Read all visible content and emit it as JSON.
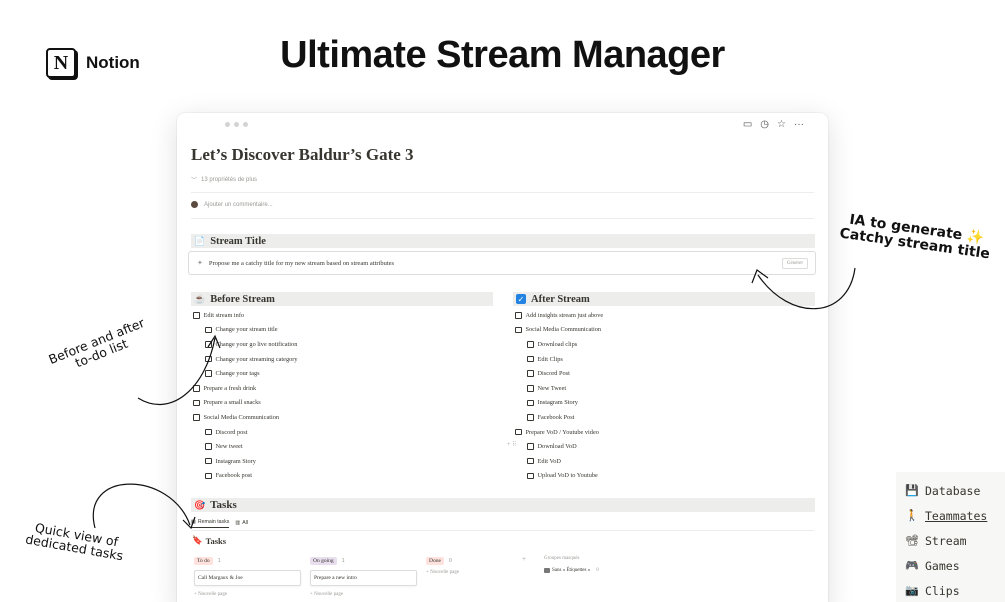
{
  "brand": {
    "logo_letter": "N",
    "name": "Notion"
  },
  "headline": "Ultimate Stream Manager",
  "window": {
    "top_icons": [
      "comment-icon",
      "history-icon",
      "star-icon",
      "more-icon"
    ],
    "top_icon_glyphs": [
      "▭",
      "◷",
      "☆",
      "···"
    ],
    "page_title": "Let’s Discover Baldur’s Gate 3",
    "properties_toggle": "13 propriétés de plus",
    "comment_placeholder": "Ajouter un commentaire...",
    "stream_title": {
      "icon": "📄",
      "heading": "Stream Title",
      "ai_prompt": "Propose me a catchy title for my new stream based on stream attributes",
      "generate_label": "Générer"
    },
    "before": {
      "icon": "☕",
      "heading": "Before Stream",
      "items": [
        {
          "label": "Edit stream info",
          "level": 0
        },
        {
          "label": "Change your stream title",
          "level": 1
        },
        {
          "label": "Change your go live notification",
          "level": 1
        },
        {
          "label": "Change your streaming category",
          "level": 1
        },
        {
          "label": "Change your tags",
          "level": 1
        },
        {
          "label": "Prepare a fresh drink",
          "level": 0
        },
        {
          "label": "Prepare a small snacks",
          "level": 0
        },
        {
          "label": "Social Media Communication",
          "level": 0
        },
        {
          "label": "Discord post",
          "level": 1
        },
        {
          "label": "New tweet",
          "level": 1
        },
        {
          "label": "Instagram Story",
          "level": 1
        },
        {
          "label": "Facebook post",
          "level": 1
        }
      ]
    },
    "after": {
      "icon": "✓",
      "heading": "After Stream",
      "items": [
        {
          "label": "Add insights stream just above",
          "level": 0
        },
        {
          "label": "Social Media Communication",
          "level": 0
        },
        {
          "label": "Download clips",
          "level": 1
        },
        {
          "label": "Edit Clips",
          "level": 1
        },
        {
          "label": "Discord Post",
          "level": 1
        },
        {
          "label": "New Tweet",
          "level": 1
        },
        {
          "label": "Instagram Story",
          "level": 1
        },
        {
          "label": "Facebook Post",
          "level": 1
        },
        {
          "label": "Prepare VoD / Youtube video",
          "level": 0
        },
        {
          "label": "Download VoD",
          "level": 1
        },
        {
          "label": "Edit VoD",
          "level": 1
        },
        {
          "label": "Upload VoD to Youtube",
          "level": 1
        }
      ]
    },
    "tasks": {
      "icon": "🎯",
      "heading": "Tasks",
      "tabs": [
        "Remain tasks",
        "All"
      ],
      "sub_icon": "🔖",
      "sub_heading": "Tasks",
      "columns": [
        {
          "label": "To do",
          "count": "1",
          "card": "Call Margaux & Joe",
          "new_page": "+ Nouvelle page",
          "color": "#ffe2dd"
        },
        {
          "label": "On going",
          "count": "1",
          "card": "Prepare a new intro",
          "new_page": "+ Nouvelle page",
          "color": "#e8deee"
        },
        {
          "label": "Done",
          "count": "0",
          "card": "",
          "new_page": "+ Nouvelle page",
          "color": "#ffe2dd"
        }
      ],
      "hidden_groups_label": "Groupes masqués",
      "hidden_groups_item": "Sans « Étiquettes »",
      "hidden_groups_count": "0"
    }
  },
  "annotations": {
    "ia_line1": "IA to generate",
    "ia_sparkle": "✨",
    "ia_line2": "Catchy stream title",
    "before_after_line1": "Before and after",
    "before_after_line2": "to-do list",
    "quick_view_line1": "Quick view of",
    "quick_view_line2": "dedicated tasks"
  },
  "side_nav": [
    {
      "icon": "💾",
      "label": "Database",
      "link": false
    },
    {
      "icon": "🚶",
      "label": "Teammates",
      "link": true
    },
    {
      "icon": "📽",
      "label": "Stream",
      "link": false
    },
    {
      "icon": "🎮",
      "label": "Games",
      "link": false
    },
    {
      "icon": "📷",
      "label": "Clips",
      "link": false
    }
  ]
}
